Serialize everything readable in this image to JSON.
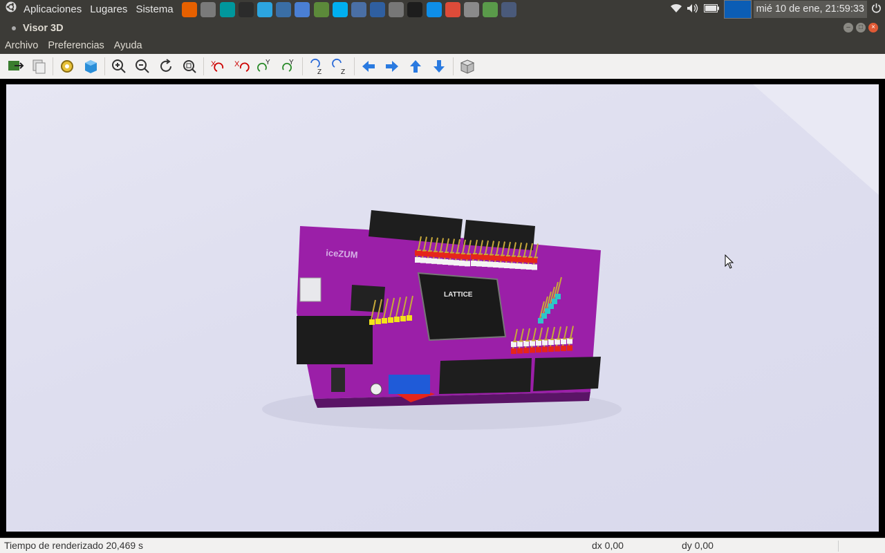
{
  "panel": {
    "menus": [
      "Aplicaciones",
      "Lugares",
      "Sistema"
    ],
    "launchers": [
      {
        "name": "firefox-icon",
        "color": "#e66000"
      },
      {
        "name": "file-manager-icon",
        "color": "#7a7a7a"
      },
      {
        "name": "arduino-icon",
        "color": "#00979c"
      },
      {
        "name": "terminal-icon",
        "color": "#2b2b2b"
      },
      {
        "name": "telegram-icon",
        "color": "#2ca5e0"
      },
      {
        "name": "remote-desktop-icon",
        "color": "#3a6ea5"
      },
      {
        "name": "chromium-icon",
        "color": "#4a7fd4"
      },
      {
        "name": "system-monitor-icon",
        "color": "#5c8a3a"
      },
      {
        "name": "skype-icon",
        "color": "#00aff0"
      },
      {
        "name": "info-icon",
        "color": "#4a6fa5"
      },
      {
        "name": "virtualbox-icon",
        "color": "#2f5fa0"
      },
      {
        "name": "calculator-icon",
        "color": "#777777"
      },
      {
        "name": "media-player-icon",
        "color": "#1d1d1d"
      },
      {
        "name": "teamviewer-icon",
        "color": "#0e8ee9"
      },
      {
        "name": "chrome-icon",
        "color": "#dd4b39"
      },
      {
        "name": "keyboard-icon",
        "color": "#8a8a8a"
      },
      {
        "name": "network-globe-icon",
        "color": "#5a9a4a"
      },
      {
        "name": "display-icon",
        "color": "#4a5a7a"
      }
    ],
    "clock": "mié 10 de ene, 21:59:33"
  },
  "window": {
    "title": "Visor 3D"
  },
  "menubar": [
    "Archivo",
    "Preferencias",
    "Ayuda"
  ],
  "toolbar": [
    "export-icon",
    "copy-icon",
    "settings-icon",
    "render-mode-icon",
    "zoom-in-icon",
    "zoom-out-icon",
    "redraw-icon",
    "zoom-fit-icon",
    "rotate-x-cw-icon",
    "rotate-x-ccw-icon",
    "rotate-y-cw-icon",
    "rotate-y-ccw-icon",
    "rotate-z-cw-icon",
    "rotate-z-ccw-icon",
    "pan-left-icon",
    "pan-right-icon",
    "pan-up-icon",
    "pan-down-icon",
    "orthographic-icon"
  ],
  "board": {
    "brand": "iceZUM",
    "chip_label": "LATTICE",
    "colors": {
      "pcb": "#9b1fa8",
      "header": "#1e1e1e",
      "pin": "#c8a93a",
      "red": "#e5251b",
      "white": "#f4f4f4",
      "yellow": "#f2e21a",
      "cyan": "#2ec5c9",
      "blue": "#1f5bd8"
    }
  },
  "status": {
    "render_time": "Tiempo de renderizado 20,469 s",
    "dx": "dx 0,00",
    "dy": "dy 0,00"
  }
}
